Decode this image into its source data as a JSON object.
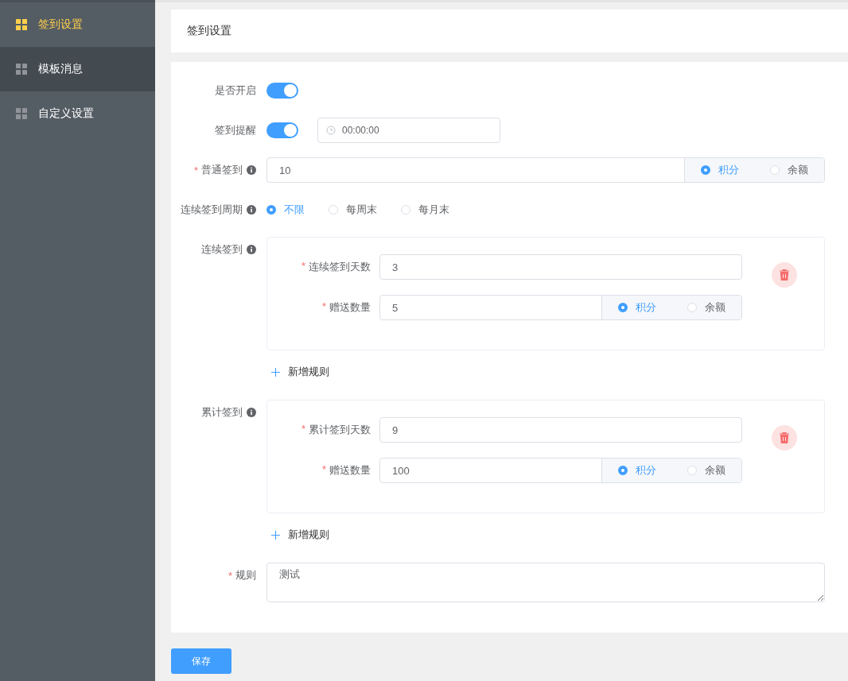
{
  "sidebar": {
    "items": [
      {
        "label": "签到设置",
        "selected": true,
        "hovered": false
      },
      {
        "label": "模板消息",
        "selected": false,
        "hovered": true
      },
      {
        "label": "自定义设置",
        "selected": false,
        "hovered": false
      }
    ]
  },
  "page_title": "签到设置",
  "form": {
    "enable": {
      "label": "是否开启",
      "on": true
    },
    "reminder": {
      "label": "签到提醒",
      "on": true,
      "time": "00:00:00"
    },
    "normal": {
      "mark": "*",
      "label": "普通签到",
      "value": "10",
      "units": [
        {
          "label": "积分",
          "selected": true
        },
        {
          "label": "余额",
          "selected": false
        }
      ]
    },
    "cycle": {
      "label": "连续签到周期",
      "options": [
        {
          "label": "不限",
          "selected": true
        },
        {
          "label": "每周末",
          "selected": false
        },
        {
          "label": "每月末",
          "selected": false
        }
      ]
    },
    "groups": [
      {
        "label": "连续签到",
        "rules": [
          {
            "days_mark": "*",
            "days_label": "连续签到天数",
            "days": "3",
            "amount_mark": "*",
            "amount_label": "赠送数量",
            "amount": "5",
            "units": [
              {
                "label": "积分",
                "selected": true
              },
              {
                "label": "余额",
                "selected": false
              }
            ]
          }
        ],
        "add_label": "新增规则"
      },
      {
        "label": "累计签到",
        "rules": [
          {
            "days_mark": "*",
            "days_label": "累计签到天数",
            "days": "9",
            "amount_mark": "*",
            "amount_label": "赠送数量",
            "amount": "100",
            "units": [
              {
                "label": "积分",
                "selected": true
              },
              {
                "label": "余额",
                "selected": false
              }
            ]
          }
        ],
        "add_label": "新增规则"
      }
    ],
    "rule": {
      "mark": "*",
      "label": "规则",
      "value": "测试"
    }
  },
  "save": "保存"
}
